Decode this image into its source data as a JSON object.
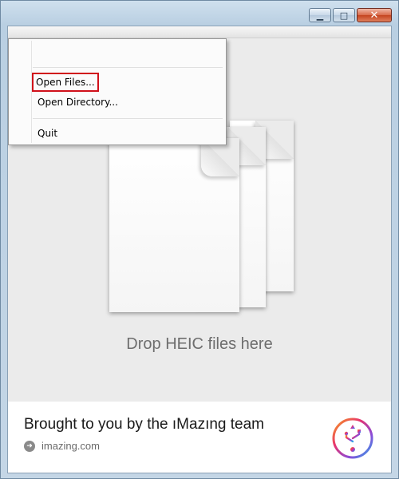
{
  "window": {
    "minimize_glyph": "▁",
    "maximize_glyph": "□",
    "close_glyph": "✕"
  },
  "menu": {
    "items": [
      {
        "label": "Open Files...",
        "highlighted": true
      },
      {
        "label": "Open Directory...",
        "highlighted": false
      },
      {
        "label": "Quit",
        "highlighted": false
      }
    ]
  },
  "dropzone": {
    "label": "Drop HEIC files here"
  },
  "footer": {
    "title": "Brought to you by the ıMazıng team",
    "link": "imazing.com",
    "link_icon": "arrow-right-circle-icon",
    "logo_icon": "usb-gradient-logo-icon"
  },
  "colors": {
    "highlight_border": "#d0101a",
    "client_bg": "#ebebeb",
    "footer_bg": "#ffffff"
  }
}
